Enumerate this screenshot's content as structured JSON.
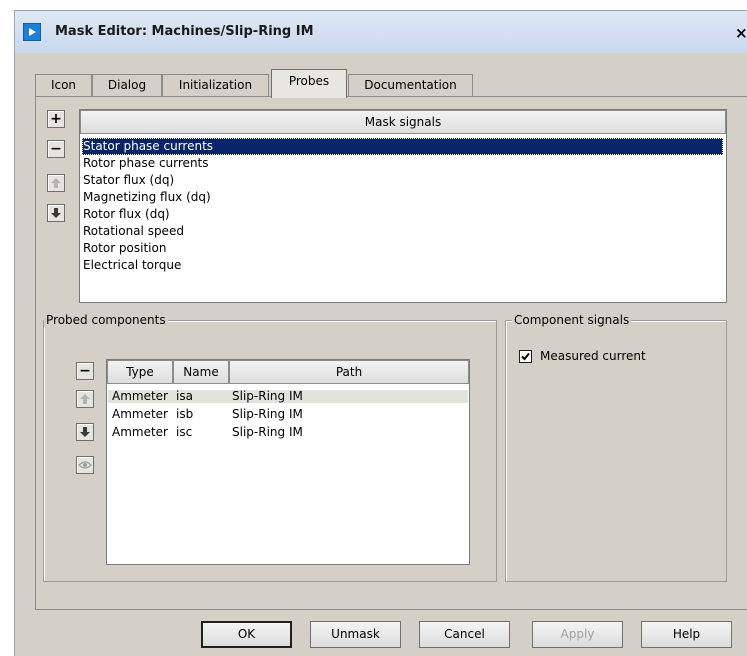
{
  "window": {
    "title": "Mask Editor: Machines/Slip-Ring IM",
    "close": "×"
  },
  "tabs": [
    {
      "label": "Icon"
    },
    {
      "label": "Dialog"
    },
    {
      "label": "Initialization"
    },
    {
      "label": "Probes"
    },
    {
      "label": "Documentation"
    }
  ],
  "mask_signals": {
    "header": "Mask signals",
    "buttons": {
      "add": "+",
      "remove": "−"
    },
    "items": [
      "Stator phase currents",
      "Rotor phase currents",
      "Stator flux (dq)",
      "Magnetizing flux (dq)",
      "Rotor flux (dq)",
      "Rotational speed",
      "Rotor position",
      "Electrical torque"
    ]
  },
  "probed_components": {
    "legend": "Probed components",
    "buttons": {
      "remove": "−"
    },
    "columns": {
      "type": "Type",
      "name": "Name",
      "path": "Path"
    },
    "rows": [
      {
        "type": "Ammeter",
        "name": "isa",
        "path": "Slip-Ring IM"
      },
      {
        "type": "Ammeter",
        "name": "isb",
        "path": "Slip-Ring IM"
      },
      {
        "type": "Ammeter",
        "name": "isc",
        "path": "Slip-Ring IM"
      }
    ]
  },
  "component_signals": {
    "legend": "Component signals",
    "items": [
      {
        "label": "Measured current",
        "checked": true
      }
    ]
  },
  "footer": {
    "ok": "OK",
    "unmask": "Unmask",
    "cancel": "Cancel",
    "apply": "Apply",
    "help": "Help"
  }
}
